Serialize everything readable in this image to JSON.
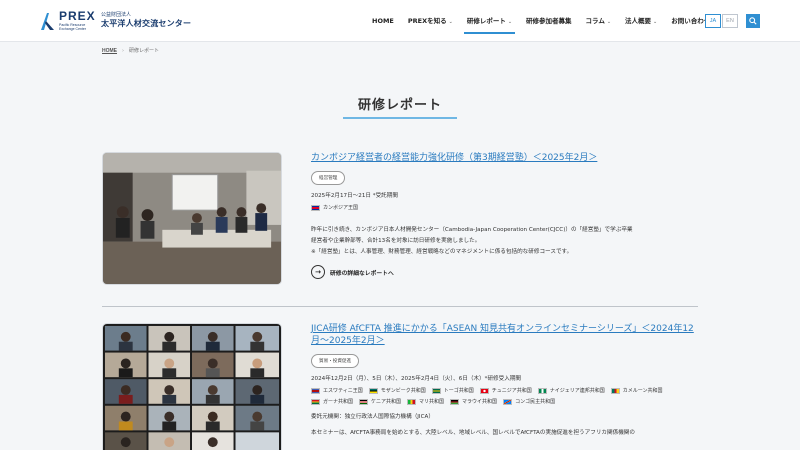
{
  "header": {
    "logo_text": "PREX",
    "logo_subtext": "Pacific Resource Exchange Center",
    "logo_jp_small": "公益財団法人",
    "logo_jp_name": "太平洋人材交流センター",
    "nav": [
      {
        "label": "HOME",
        "caret": false,
        "active": false
      },
      {
        "label": "PREXを知る",
        "caret": true,
        "active": false
      },
      {
        "label": "研修レポート",
        "caret": true,
        "active": true
      },
      {
        "label": "研修参加者募集",
        "caret": false,
        "active": false
      },
      {
        "label": "コラム",
        "caret": true,
        "active": false
      },
      {
        "label": "法人概要",
        "caret": true,
        "active": false
      },
      {
        "label": "お問い合わせ",
        "caret": false,
        "active": false
      }
    ],
    "lang_ja": "JA",
    "lang_en": "EN",
    "search_icon": "search-icon",
    "accent_color": "#2f8fd2"
  },
  "breadcrumb": {
    "home": "HOME",
    "current": "研修レポート"
  },
  "page_title": "研修レポート",
  "reports": [
    {
      "title": "カンボジア経営者の経営能力強化研修（第3期経営塾）＜2025年2月＞",
      "tag": "経営管理",
      "period": "2025年2月17日〜21日 *受託期間",
      "countries": [
        {
          "name": "カンボジア王国",
          "flag": "cambodia"
        }
      ],
      "description": [
        "昨年に引き続き、カンボジア日本人材開発センター（Cambodia-Japan Cooperation Center(CJCC)）の「経営塾」で学ぶ卒業",
        "経営者や企業幹部等、合計13名を対象に訪日研修を実施しました。",
        "※「経営塾」とは、人事管理、財務管理、経営戦略などのマネジメントに係る包括的な研修コースです。"
      ],
      "more_label": "研修の詳細なレポートへ"
    },
    {
      "title": "JICA研修 AfCFTA 推進にかかる「ASEAN 知見共有オンラインセミナーシリーズ」＜2024年12月〜2025年2月＞",
      "tag": "貿易・投資促進",
      "period": "2024年12月2日（月）、5日（木）、2025年2月4日（火）、6日（木）*研修受入期間",
      "countries": [
        {
          "name": "エスワティニ王国",
          "flag": "eswatini"
        },
        {
          "name": "モザンビーク共和国",
          "flag": "mozambique"
        },
        {
          "name": "トーゴ共和国",
          "flag": "togo"
        },
        {
          "name": "チュニジア共和国",
          "flag": "tunisia"
        },
        {
          "name": "ナイジェリア連邦共和国",
          "flag": "nigeria"
        },
        {
          "name": "カメルーン共和国",
          "flag": "cameroon"
        },
        {
          "name": "ガーナ共和国",
          "flag": "ghana"
        },
        {
          "name": "ケニア共和国",
          "flag": "kenya"
        },
        {
          "name": "マリ共和国",
          "flag": "mali"
        },
        {
          "name": "マラウイ共和国",
          "flag": "malawi"
        },
        {
          "name": "コンゴ民主共和国",
          "flag": "drc"
        }
      ],
      "client": "委託元機関：独立行政法人国際協力機構（JICA）",
      "description": [
        "本セミナーは、AfCFTA事務局を始めとする、大陸レベル、地域レベル、国レベルでAfCFTAの実施促進を担うアフリカ関係機関の"
      ]
    }
  ]
}
